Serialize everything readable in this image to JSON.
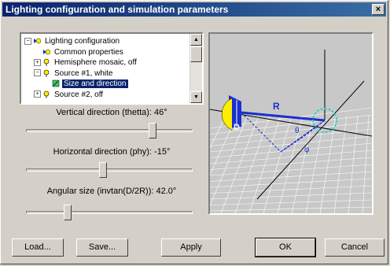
{
  "window": {
    "title": "Lighting configuration and simulation parameters"
  },
  "tree": {
    "items": [
      {
        "label": "Lighting configuration",
        "indent": 0,
        "expander": "-",
        "icon": "lights-icon"
      },
      {
        "label": "Common properties",
        "indent": 1,
        "expander": "",
        "icon": "lights-icon"
      },
      {
        "label": "Hemisphere mosaic, off",
        "indent": 1,
        "expander": "+",
        "icon": "bulb-icon"
      },
      {
        "label": "Source #1, white",
        "indent": 1,
        "expander": "-",
        "icon": "bulb-icon"
      },
      {
        "label": "Size and direction",
        "indent": 2,
        "expander": "",
        "icon": "ruler-icon",
        "selected": true
      },
      {
        "label": "Source #2, off",
        "indent": 1,
        "expander": "+",
        "icon": "bulb-icon"
      }
    ]
  },
  "sliders": [
    {
      "label": "Vertical direction (thetta): 46°",
      "fraction": 0.76
    },
    {
      "label": "Horizontal direction (phy): -15°",
      "fraction": 0.46
    },
    {
      "label": "Angular size (invtan(D/2R)): 42.0°",
      "fraction": 0.25
    }
  ],
  "diagram": {
    "labels": {
      "r": "R",
      "d": "D",
      "theta": "θ",
      "phi": "φ"
    },
    "colors": {
      "source": "#ffee00",
      "vector": "#1a2fcf",
      "target": "#33cccc",
      "grid": "#ffffff",
      "axis": "#000000"
    }
  },
  "buttons": {
    "load": "Load...",
    "save": "Save...",
    "apply": "Apply",
    "ok": "OK",
    "cancel": "Cancel"
  }
}
